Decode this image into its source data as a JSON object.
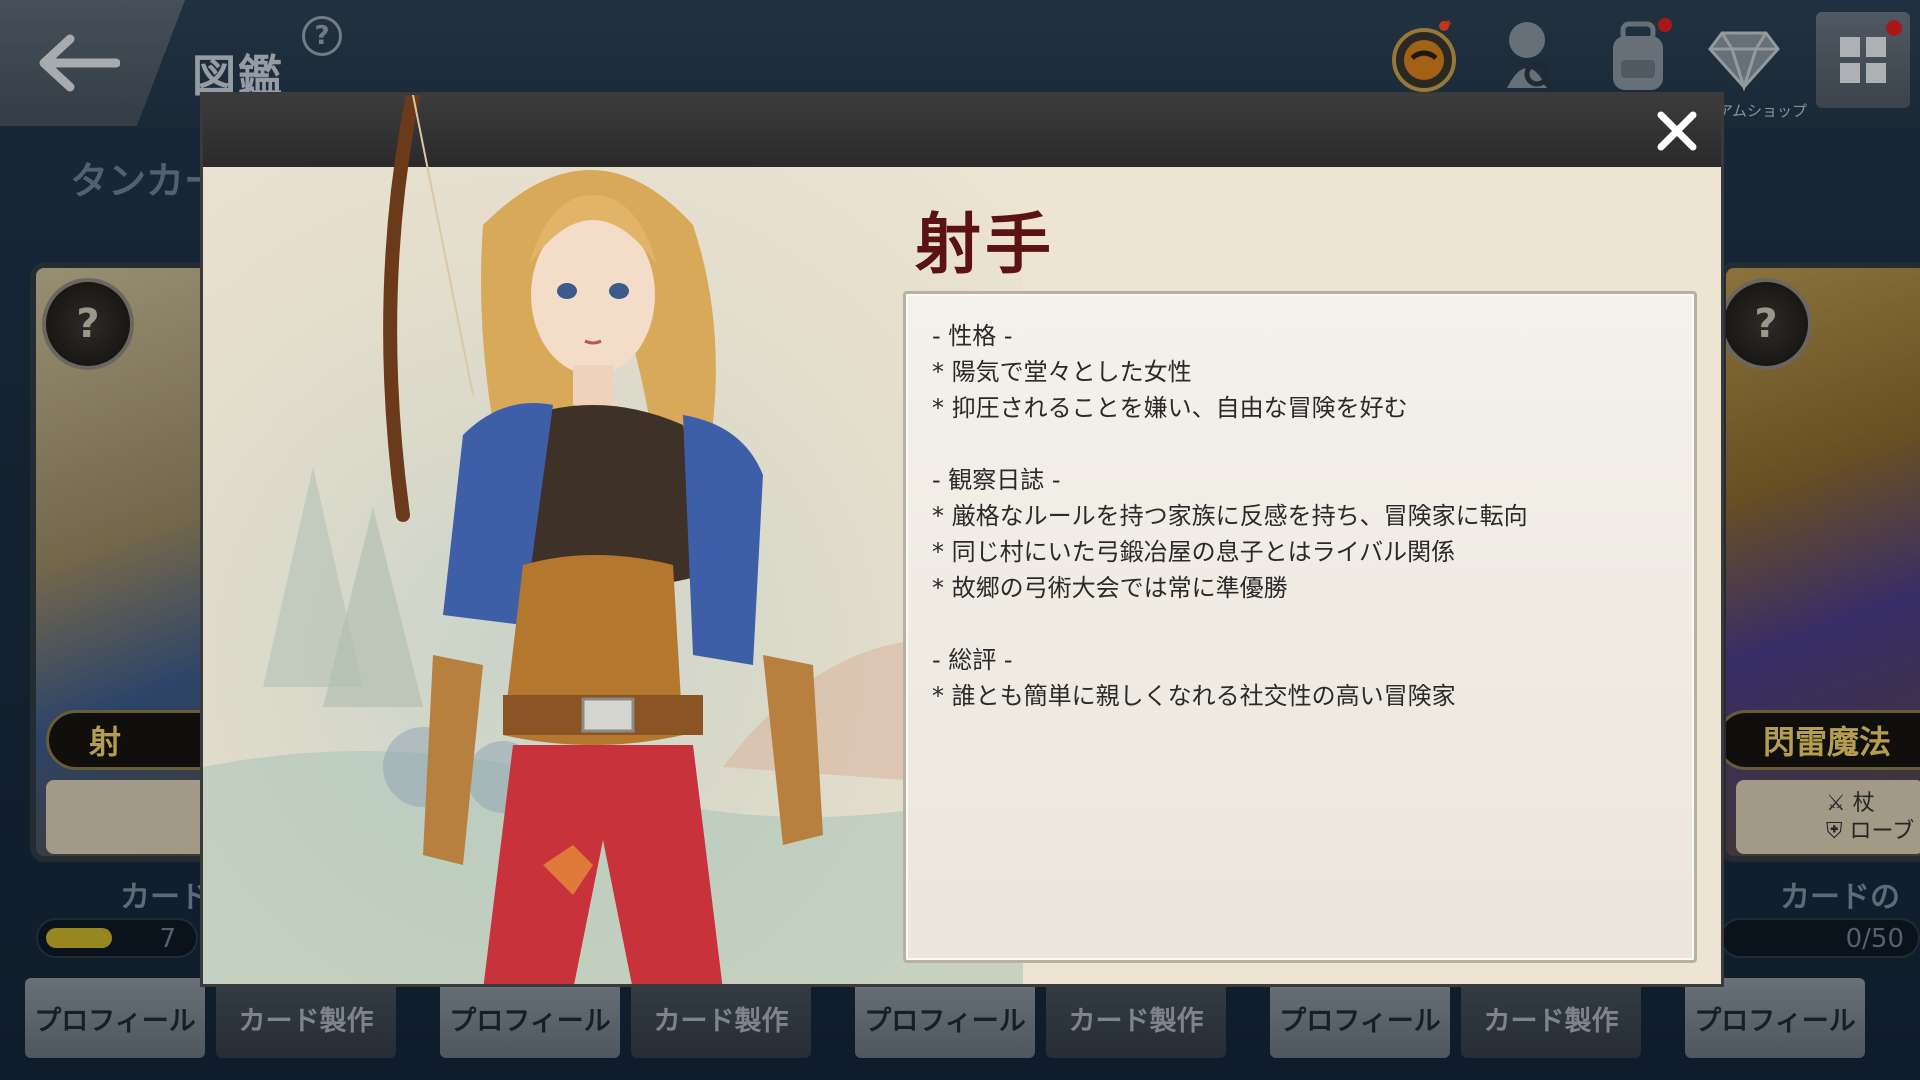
{
  "header": {
    "title": "図鑑",
    "help_symbol": "?",
    "shop_label": "アムショップ"
  },
  "tab": {
    "label": "タンカー"
  },
  "side_cards": {
    "left": {
      "name_fragment": "射",
      "collect_label": "カード",
      "progress_text": "7",
      "progress_fraction": 0.45
    },
    "right": {
      "name": "閃雷魔法",
      "equip_weapon": "杖",
      "equip_armor": "ローブ",
      "collect_label": "カードの欠",
      "progress_text": "0/50",
      "progress_fraction": 0
    }
  },
  "bottom_buttons": [
    {
      "label": "プロフィール",
      "type": "profile"
    },
    {
      "label": "カード製作",
      "type": "craft"
    },
    {
      "label": "プロフィール",
      "type": "profile"
    },
    {
      "label": "カード製作",
      "type": "craft"
    },
    {
      "label": "プロフィール",
      "type": "profile"
    },
    {
      "label": "カード製作",
      "type": "craft"
    },
    {
      "label": "プロフィール",
      "type": "profile"
    },
    {
      "label": "カード製作",
      "type": "craft"
    },
    {
      "label": "プロフィール",
      "type": "profile"
    }
  ],
  "modal": {
    "title": "射手",
    "sections": [
      {
        "heading": "- 性格 -",
        "lines": [
          "* 陽気で堂々とした女性",
          "* 抑圧されることを嫌い、自由な冒険を好む"
        ]
      },
      {
        "heading": "- 観察日誌 -",
        "lines": [
          "* 厳格なルールを持つ家族に反感を持ち、冒険家に転向",
          "* 同じ村にいた弓鍛冶屋の息子とはライバル関係",
          "* 故郷の弓術大会では常に準優勝"
        ]
      },
      {
        "heading": "- 総評 -",
        "lines": [
          "* 誰とも簡単に親しくなれる社交性の高い冒険家"
        ]
      }
    ]
  },
  "icons": {
    "back": "back-arrow-icon",
    "help": "help-icon",
    "event": "event-bomb-icon",
    "search_user": "search-user-icon",
    "backpack": "backpack-icon",
    "gem_shop": "gem-icon",
    "menu": "menu-grid-icon",
    "close": "close-icon"
  },
  "colors": {
    "modal_title": "#5a1212",
    "notification_dot": "#e02020",
    "card_name": "#f0d26a"
  }
}
